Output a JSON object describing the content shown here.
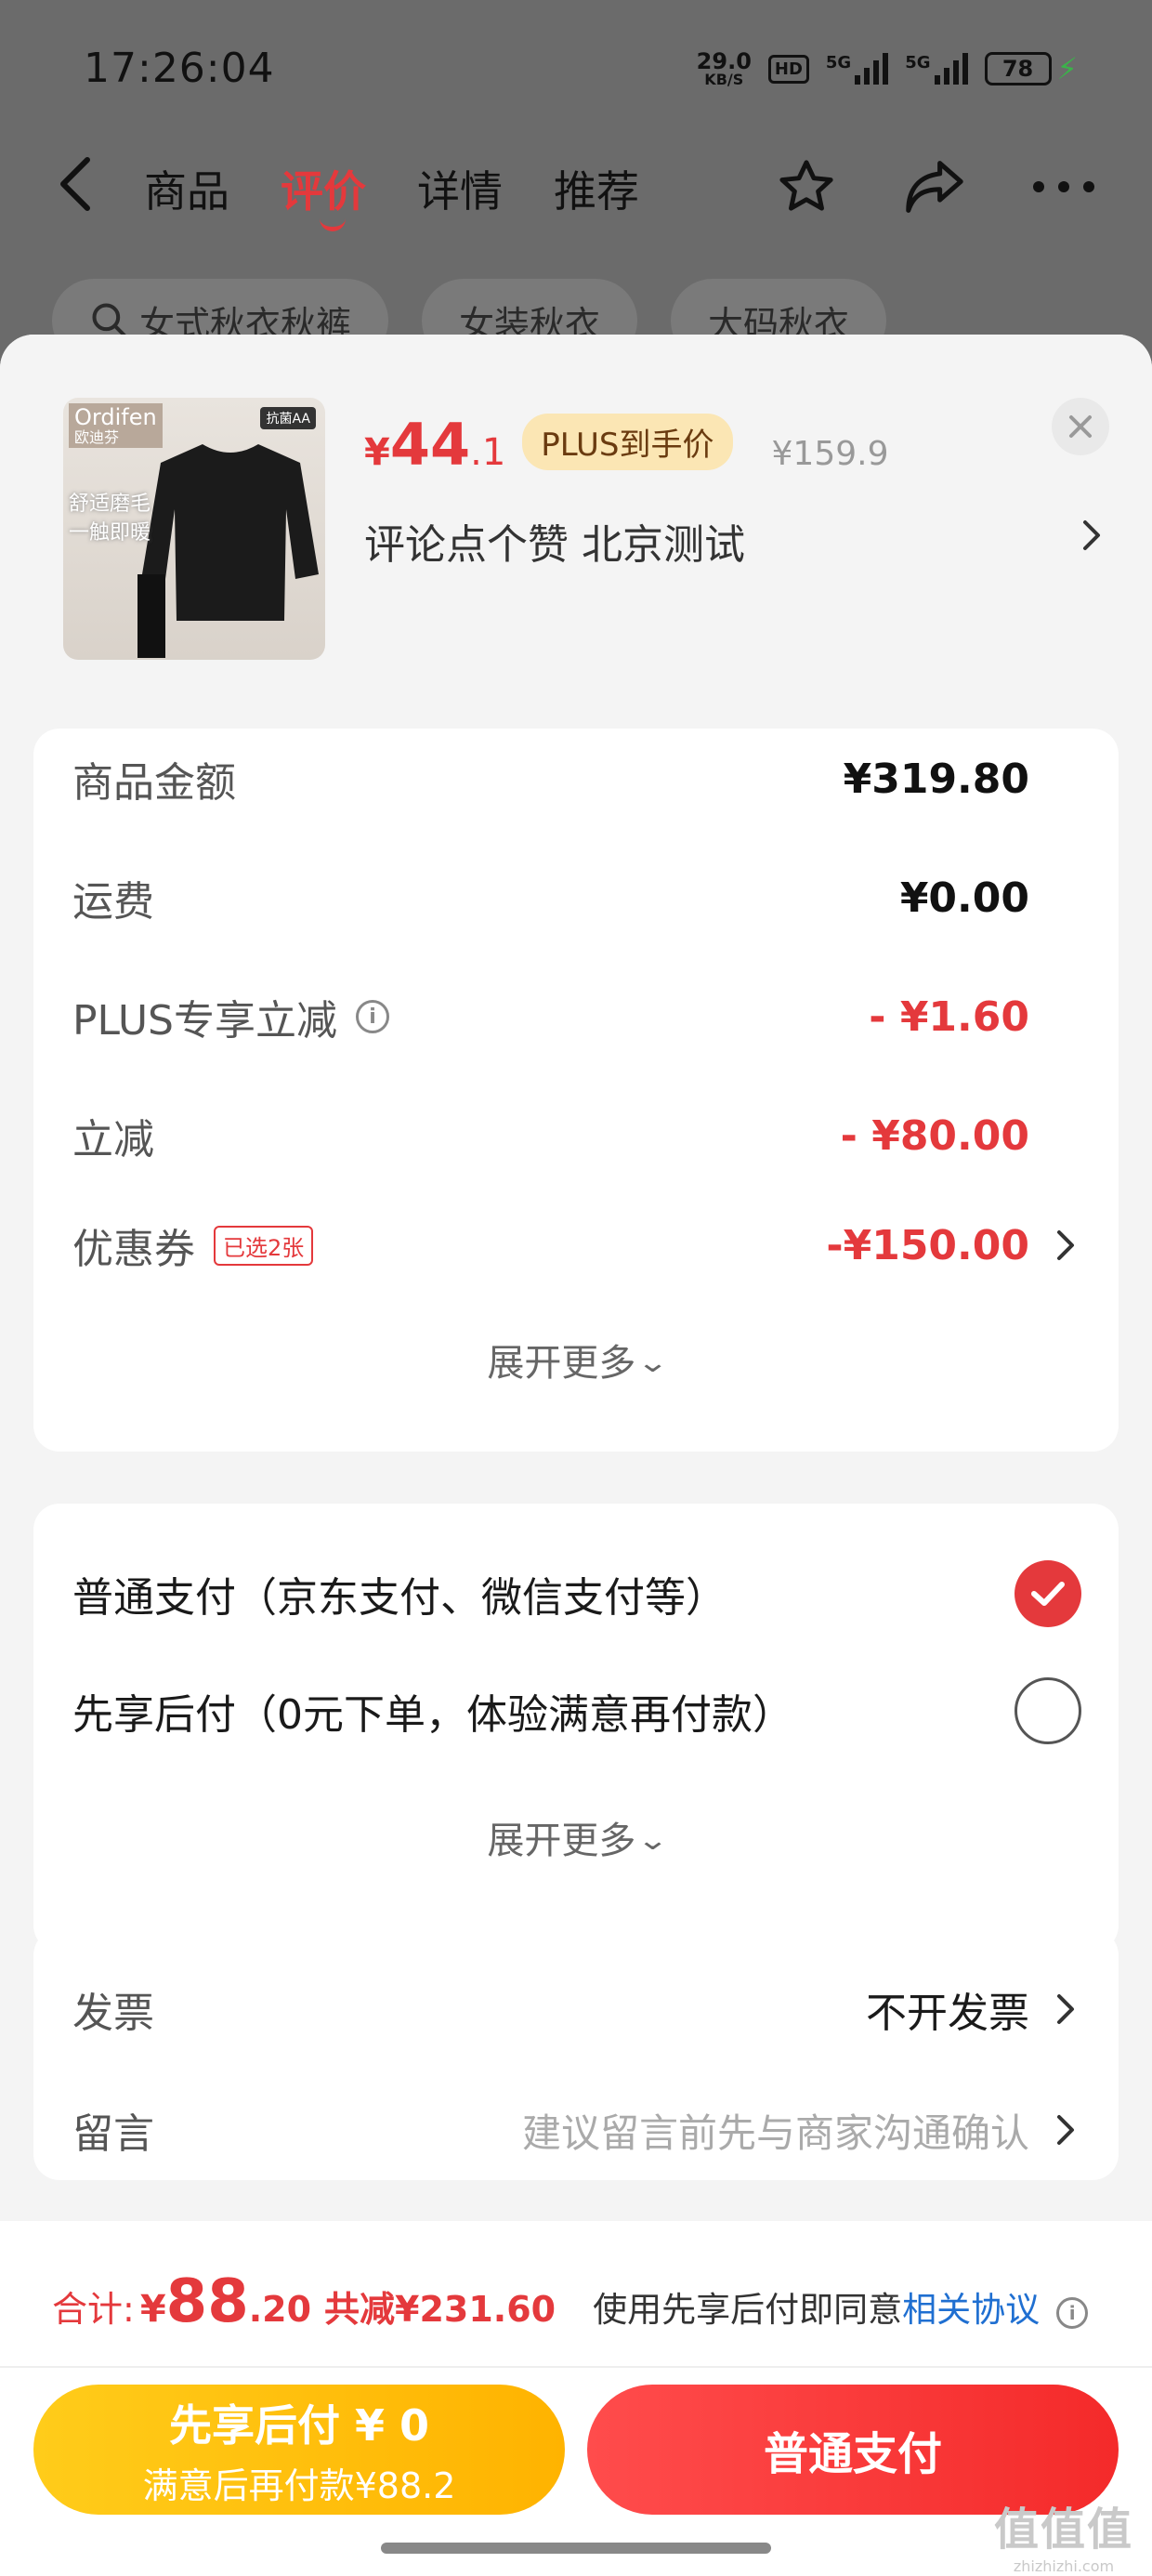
{
  "status_bar": {
    "time": "17:26:04",
    "net_speed_value": "29.0",
    "net_speed_unit": "KB/S",
    "hd_label": "HD",
    "sim1_label": "5G",
    "sim2_label": "5G",
    "battery_level": "78"
  },
  "nav": {
    "tabs": [
      {
        "label": "商品",
        "active": false
      },
      {
        "label": "评价",
        "active": true
      },
      {
        "label": "详情",
        "active": false
      },
      {
        "label": "推荐",
        "active": false
      }
    ]
  },
  "background_chips": [
    "女式秋衣秋裤",
    "女装秋衣",
    "大码秋衣"
  ],
  "product": {
    "thumb_brand": "Ordifen",
    "thumb_brand_cn": "欧迪芬",
    "thumb_badge": "抗菌AA",
    "thumb_text_line1": "舒适磨毛",
    "thumb_text_line2": "一触即暖",
    "price_symbol": "¥",
    "price_int": "44",
    "price_dec": ".1",
    "plus_badge": "PLUS到手价",
    "original_price": "¥159.9",
    "spec": "评论点个赞  北京测试"
  },
  "fees": {
    "rows": [
      {
        "label": "商品金额",
        "value": "¥319.80"
      },
      {
        "label": "运费",
        "value": "¥0.00"
      },
      {
        "label": "PLUS专享立减",
        "value": "- ¥1.60"
      },
      {
        "label": "立减",
        "value": "- ¥80.00"
      },
      {
        "label": "优惠券",
        "value": "-¥150.00",
        "tag": "已选2张"
      }
    ],
    "expand_label": "展开更多"
  },
  "payment": {
    "options": [
      {
        "label": "普通支付（京东支付、微信支付等）",
        "selected": true
      },
      {
        "label": "先享后付（0元下单，体验满意再付款）",
        "selected": false
      }
    ],
    "expand_label": "展开更多"
  },
  "invoice": {
    "label": "发票",
    "value": "不开发票"
  },
  "message": {
    "label": "留言",
    "placeholder": "建议留言前先与商家沟通确认"
  },
  "footer": {
    "total_label": "合计:",
    "total_symbol": "¥",
    "total_int": "88",
    "total_dec": ".20",
    "total_saved": "共减¥231.60",
    "agree_text": "使用先享后付即同意",
    "agree_link": "相关协议",
    "later_button_line1": "先享后付 ¥ 0",
    "later_button_line2": "满意后再付款¥88.2",
    "pay_button": "普通支付"
  },
  "watermark": {
    "line1": "值值值",
    "line2": "zhizhizhi.com"
  },
  "colors": {
    "accent_red": "#e4393c",
    "gold": "#ffbf0d",
    "link_blue": "#1f6fd1"
  }
}
